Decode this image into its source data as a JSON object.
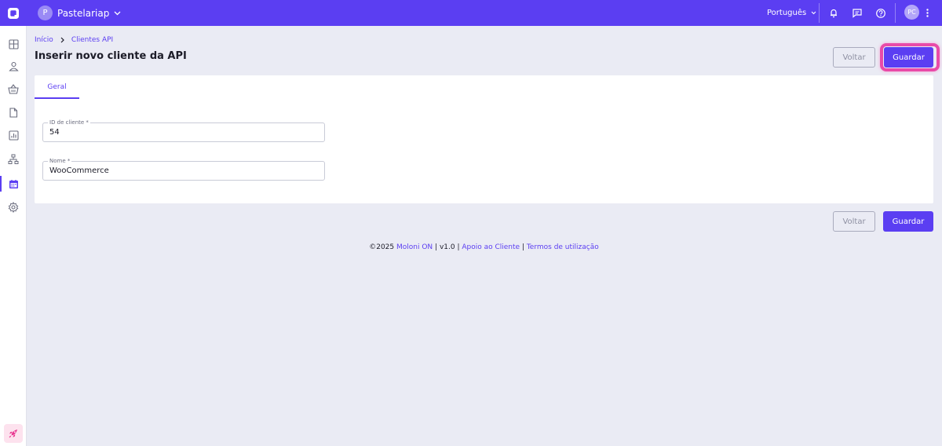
{
  "topbar": {
    "company_initial": "P",
    "company_name": "Pastelariap",
    "language": "Português",
    "user_initials": "PC"
  },
  "sidebar": {
    "items": [
      {
        "icon": "dashboard-icon"
      },
      {
        "icon": "user-icon"
      },
      {
        "icon": "basket-icon"
      },
      {
        "icon": "document-icon"
      },
      {
        "icon": "chart-icon"
      },
      {
        "icon": "network-icon"
      },
      {
        "icon": "calendar-icon",
        "active": true
      },
      {
        "icon": "gear-icon"
      }
    ],
    "bottom_icon": "rocket-icon"
  },
  "breadcrumb": {
    "home": "Início",
    "current": "Clientes API"
  },
  "page": {
    "title": "Inserir novo cliente da API",
    "back_label": "Voltar",
    "save_label": "Guardar"
  },
  "tabs": {
    "general": "Geral"
  },
  "form": {
    "client_id": {
      "label": "ID de cliente *",
      "value": "54"
    },
    "name": {
      "label": "Nome *",
      "value": "WooCommerce"
    }
  },
  "footer": {
    "copyright": "©2025",
    "brand": "Moloni ON",
    "sep1": " | ",
    "version": "v1.0",
    "sep2": " | ",
    "support": "Apoio ao Cliente",
    "sep3": " | ",
    "terms": "Termos de utilização"
  },
  "colors": {
    "accent": "#5b3ef2",
    "highlight": "#e94aa8",
    "background": "#eaebf4"
  }
}
